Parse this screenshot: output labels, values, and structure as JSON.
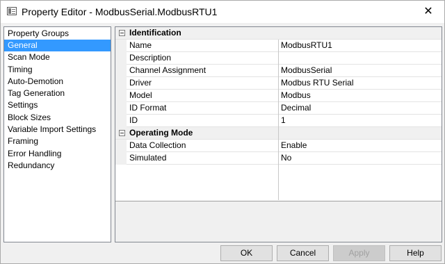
{
  "window": {
    "title": "Property Editor - ModbusSerial.ModbusRTU1",
    "close_glyph": "✕",
    "app_icon": "property-editor-icon"
  },
  "groups": {
    "header": "Property Groups",
    "selected": "General",
    "items": [
      "General",
      "Scan Mode",
      "Timing",
      "Auto-Demotion",
      "Tag Generation",
      "Settings",
      "Block Sizes",
      "Variable Import Settings",
      "Framing",
      "Error Handling",
      "Redundancy"
    ]
  },
  "grid": {
    "sections": [
      {
        "label": "Identification",
        "rows": [
          {
            "name": "Name",
            "value": "ModbusRTU1"
          },
          {
            "name": "Description",
            "value": ""
          },
          {
            "name": "Channel Assignment",
            "value": "ModbusSerial"
          },
          {
            "name": "Driver",
            "value": "Modbus RTU Serial"
          },
          {
            "name": "Model",
            "value": "Modbus"
          },
          {
            "name": "ID Format",
            "value": "Decimal"
          },
          {
            "name": "ID",
            "value": "1"
          }
        ]
      },
      {
        "label": "Operating Mode",
        "rows": [
          {
            "name": "Data Collection",
            "value": "Enable"
          },
          {
            "name": "Simulated",
            "value": "No"
          }
        ]
      }
    ]
  },
  "buttons": {
    "ok": "OK",
    "cancel": "Cancel",
    "apply": "Apply",
    "help": "Help"
  }
}
